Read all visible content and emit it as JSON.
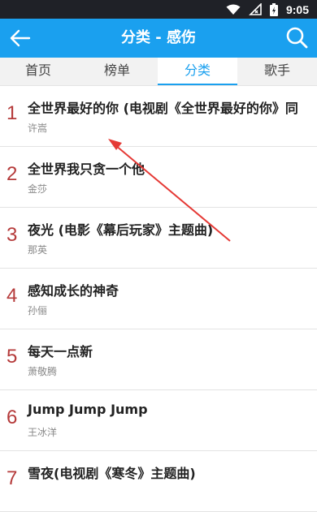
{
  "status": {
    "time": "9:05"
  },
  "header": {
    "title": "分类 - 感伤"
  },
  "tabs": [
    {
      "label": "首页"
    },
    {
      "label": "榜单"
    },
    {
      "label": "分类"
    },
    {
      "label": "歌手"
    }
  ],
  "songs": [
    {
      "num": "1",
      "title": "全世界最好的你 (电视剧《全世界最好的你》同",
      "artist": "许嵩"
    },
    {
      "num": "2",
      "title": "全世界我只贪一个他",
      "artist": "金莎"
    },
    {
      "num": "3",
      "title": "夜光 (电影《幕后玩家》主题曲)",
      "artist": "那英"
    },
    {
      "num": "4",
      "title": "感知成长的神奇",
      "artist": "孙俪"
    },
    {
      "num": "5",
      "title": "每天一点新",
      "artist": "萧敬腾"
    },
    {
      "num": "6",
      "title": "Jump Jump Jump",
      "artist": "王冰洋"
    },
    {
      "num": "7",
      "title": "雪夜(电视剧《寒冬》主题曲)",
      "artist": ""
    }
  ],
  "colors": {
    "accent": "#1aa0ef",
    "number": "#b53a3a",
    "annotation": "#e53935"
  }
}
